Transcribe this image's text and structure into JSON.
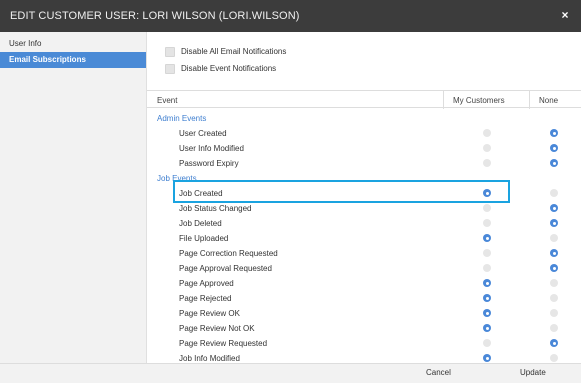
{
  "dialog": {
    "title": "EDIT CUSTOMER USER: LORI WILSON (LORI.WILSON)",
    "close_glyph": "×"
  },
  "sidebar": {
    "items": [
      {
        "label": "User Info",
        "active": false
      },
      {
        "label": "Email Subscriptions",
        "active": true
      }
    ]
  },
  "options": [
    {
      "label": "Disable All Email Notifications",
      "checked": false
    },
    {
      "label": "Disable Event Notifications",
      "checked": false
    }
  ],
  "table": {
    "headers": {
      "event": "Event",
      "my_customers": "My Customers",
      "none": "None"
    },
    "rows": [
      {
        "type": "group",
        "label": "Admin Events"
      },
      {
        "type": "event",
        "label": "User Created",
        "selected": "none"
      },
      {
        "type": "event",
        "label": "User Info Modified",
        "selected": "none"
      },
      {
        "type": "event",
        "label": "Password Expiry",
        "selected": "none"
      },
      {
        "type": "group",
        "label": "Job Events"
      },
      {
        "type": "event",
        "label": "Job Created",
        "selected": "my_customers"
      },
      {
        "type": "event",
        "label": "Job Status Changed",
        "selected": "none"
      },
      {
        "type": "event",
        "label": "Job Deleted",
        "selected": "none"
      },
      {
        "type": "event",
        "label": "File Uploaded",
        "selected": "my_customers"
      },
      {
        "type": "event",
        "label": "Page Correction Requested",
        "selected": "none"
      },
      {
        "type": "event",
        "label": "Page Approval Requested",
        "selected": "none"
      },
      {
        "type": "event",
        "label": "Page Approved",
        "selected": "my_customers"
      },
      {
        "type": "event",
        "label": "Page Rejected",
        "selected": "my_customers"
      },
      {
        "type": "event",
        "label": "Page Review OK",
        "selected": "my_customers"
      },
      {
        "type": "event",
        "label": "Page Review Not OK",
        "selected": "my_customers"
      },
      {
        "type": "event",
        "label": "Page Review Requested",
        "selected": "none"
      },
      {
        "type": "event",
        "label": "Job Info Modified",
        "selected": "my_customers"
      }
    ]
  },
  "footer": {
    "cancel_label": "Cancel",
    "update_label": "Update"
  },
  "colors": {
    "accent": "#4a88d8",
    "highlight_border": "#1aa3e0",
    "titlebar": "#3c3c3c",
    "group_text": "#3f7fd0"
  }
}
